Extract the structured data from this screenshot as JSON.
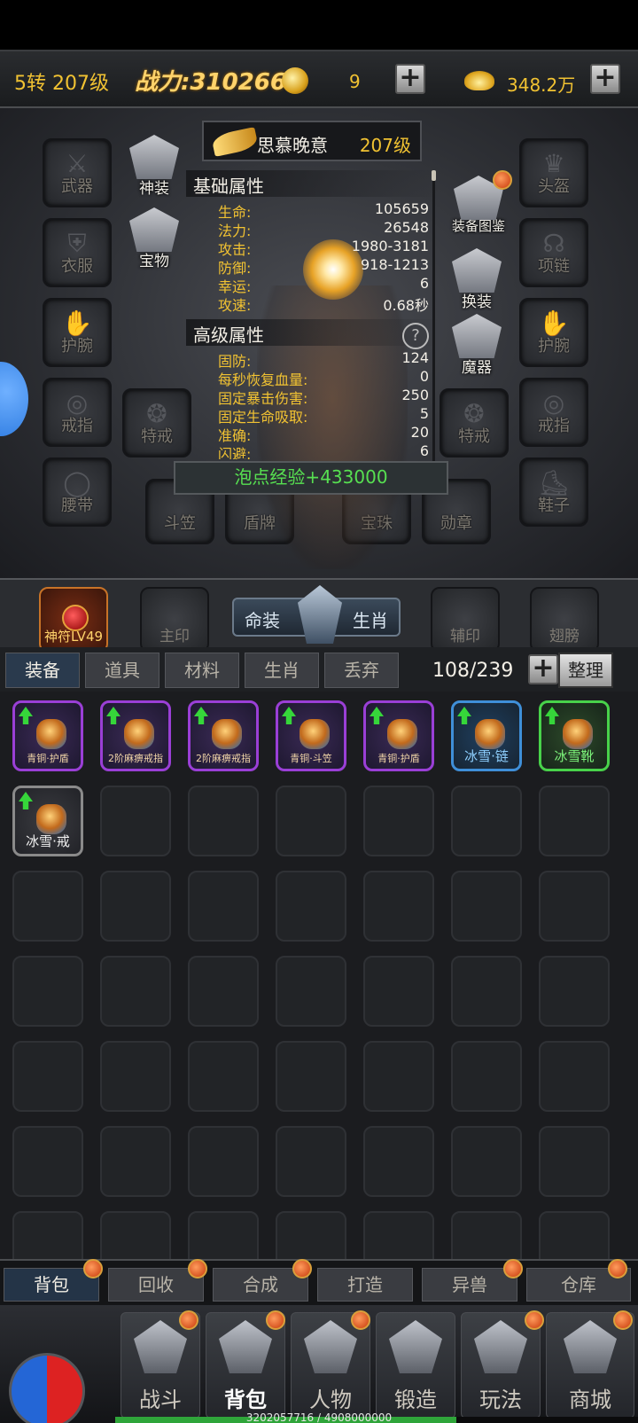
{
  "top_bar": {
    "level": "5转 207级",
    "power": "战力:310266",
    "coin_value": "9",
    "ingot_value": "348.2万",
    "plus": "+"
  },
  "character": {
    "name": "思慕晚意",
    "level": "207级",
    "left_slots": [
      "武器",
      "衣服",
      "护腕",
      "戒指",
      "腰带"
    ],
    "right_slots": [
      "头盔",
      "项链",
      "护腕",
      "戒指",
      "鞋子"
    ],
    "bottom_slots": [
      "斗笠",
      "盾牌",
      "宝珠",
      "勋章"
    ],
    "special_rings": [
      "特戒",
      "特戒"
    ],
    "left_buttons": [
      "神装",
      "宝物"
    ],
    "right_buttons": [
      "装备图鉴",
      "换装",
      "魔器"
    ],
    "basic_title": "基础属性",
    "basic_stats": [
      {
        "k": "生命:",
        "v": "105659"
      },
      {
        "k": "法力:",
        "v": "26548"
      },
      {
        "k": "攻击:",
        "v": "1980-3181"
      },
      {
        "k": "防御:",
        "v": "918-1213"
      },
      {
        "k": "幸运:",
        "v": "6"
      },
      {
        "k": "攻速:",
        "v": "0.68秒"
      }
    ],
    "advanced_title": "高级属性",
    "help": "?",
    "advanced_stats": [
      {
        "k": "固防:",
        "v": "124"
      },
      {
        "k": "每秒恢复血量:",
        "v": "0"
      },
      {
        "k": "固定暴击伤害:",
        "v": "250"
      },
      {
        "k": "固定生命吸取:",
        "v": "5"
      },
      {
        "k": "准确:",
        "v": "20"
      },
      {
        "k": "闪避:",
        "v": "6"
      }
    ],
    "exp_banner": "泡点经验+433000"
  },
  "seal_bar": {
    "shenfu": "神符LV49",
    "zhuyin": "主印",
    "mingzhuang": "命装",
    "shengxiao": "生肖",
    "fuyin": "辅印",
    "chibang": "翅膀"
  },
  "categories": {
    "tabs": [
      "装备",
      "道具",
      "材料",
      "生肖",
      "丢弃"
    ],
    "count": "108/239",
    "tidy": "整理"
  },
  "inventory": [
    {
      "name": "青铜·护盾",
      "rarity": "purple",
      "upgrade": true
    },
    {
      "name": "2阶麻痹戒指",
      "rarity": "purple",
      "upgrade": true
    },
    {
      "name": "2阶麻痹戒指",
      "rarity": "purple",
      "upgrade": true
    },
    {
      "name": "青铜·斗笠",
      "rarity": "purple",
      "upgrade": true
    },
    {
      "name": "青铜·护盾",
      "rarity": "purple",
      "upgrade": true
    },
    {
      "name": "冰雪·链",
      "rarity": "blue",
      "upgrade": true
    },
    {
      "name": "冰雪靴",
      "rarity": "green",
      "upgrade": true
    },
    {
      "name": "冰雪·戒",
      "rarity": "gray",
      "upgrade": true
    }
  ],
  "sub_tabs": [
    "背包",
    "回收",
    "合成",
    "打造",
    "异兽",
    "仓库"
  ],
  "nav": [
    "战斗",
    "背包",
    "人物",
    "锻造",
    "玩法",
    "商城"
  ],
  "exp": {
    "text": "3202057716 / 4908000000",
    "fraction": 0.652
  }
}
